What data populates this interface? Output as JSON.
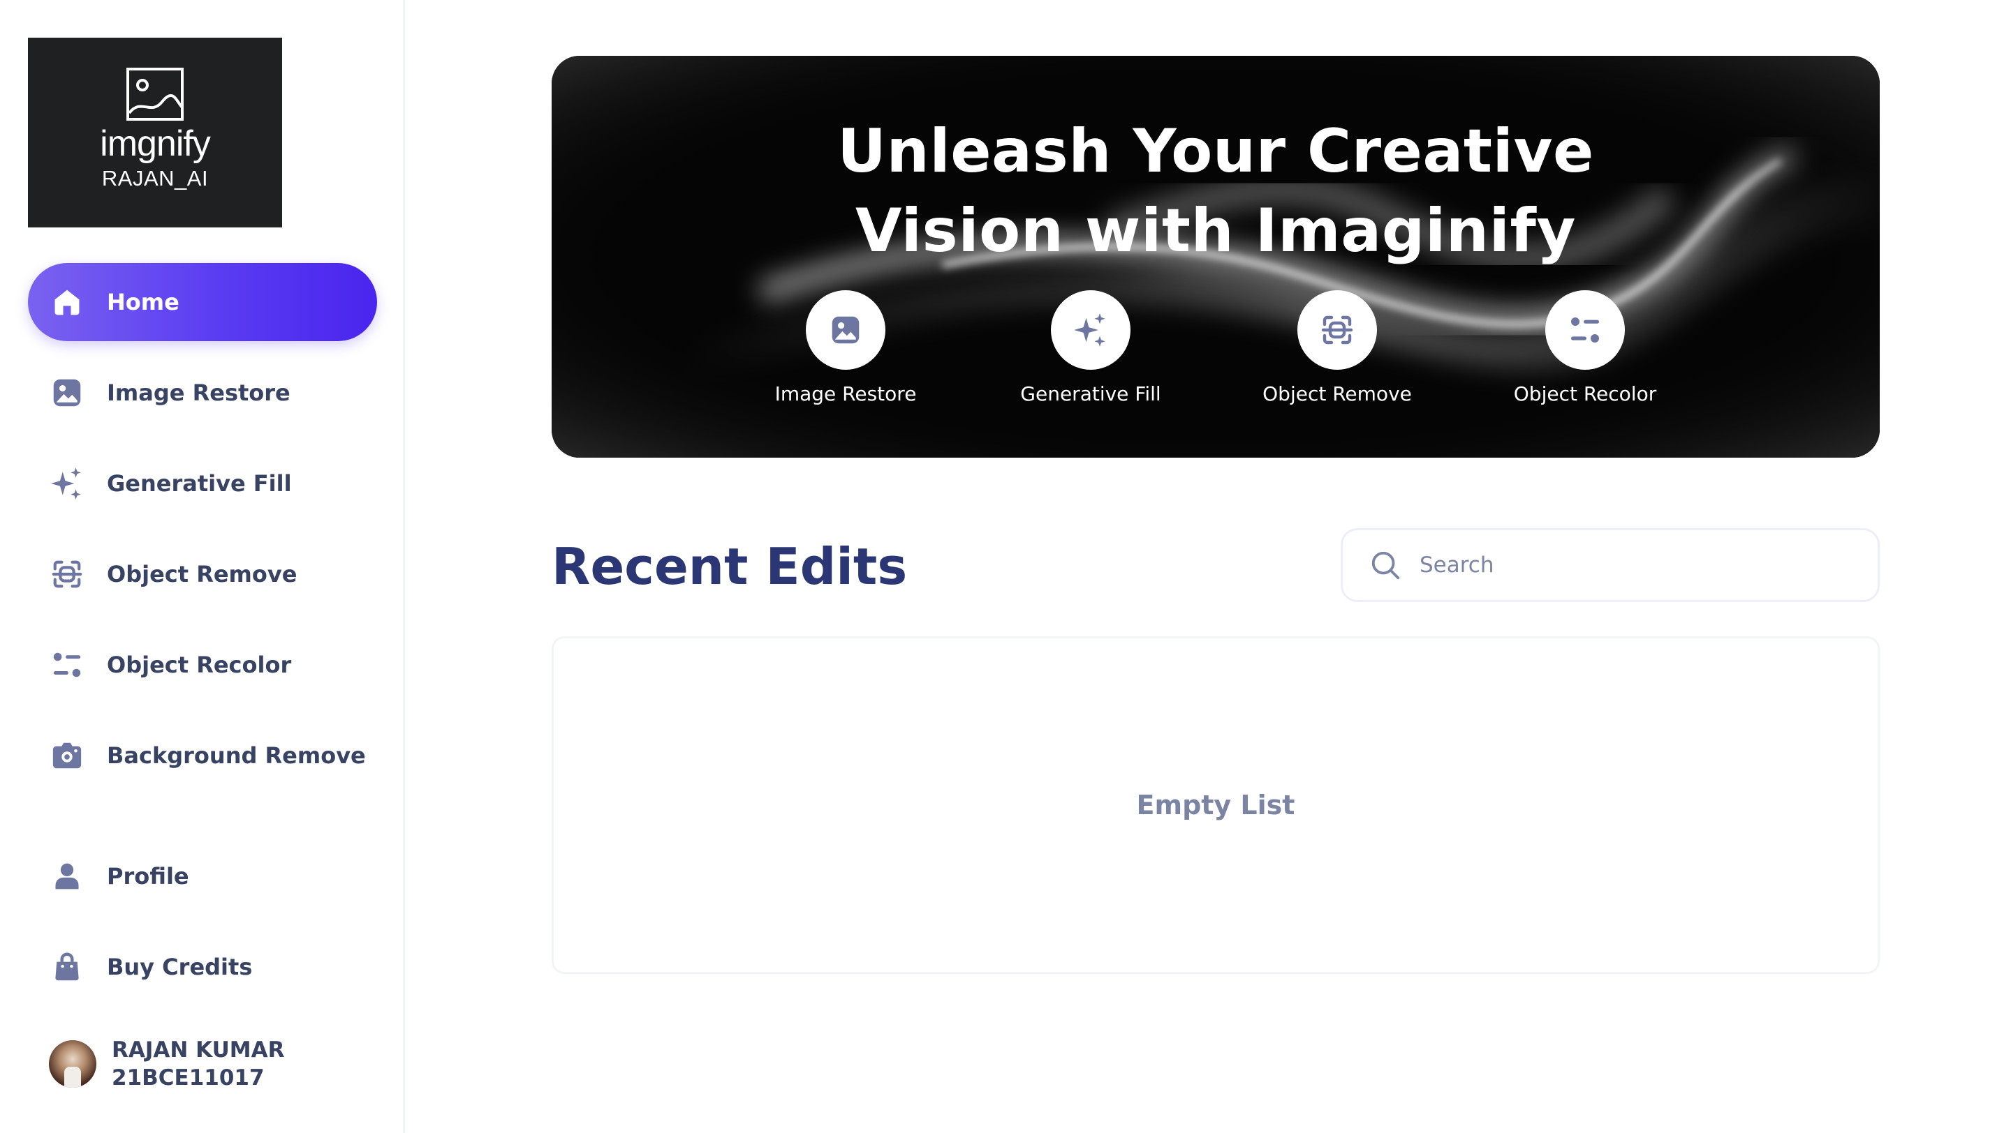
{
  "brand": {
    "name": "imgnify",
    "subtitle": "RAJAN_AI"
  },
  "sidebar": {
    "items": [
      {
        "label": "Home",
        "icon": "home-icon",
        "active": true
      },
      {
        "label": "Image Restore",
        "icon": "image-icon"
      },
      {
        "label": "Generative Fill",
        "icon": "sparkles-icon"
      },
      {
        "label": "Object Remove",
        "icon": "scan-icon"
      },
      {
        "label": "Object Recolor",
        "icon": "filter-icon"
      },
      {
        "label": "Background Remove",
        "icon": "camera-icon"
      },
      {
        "label": "Profile",
        "icon": "user-icon"
      },
      {
        "label": "Buy Credits",
        "icon": "bag-icon"
      }
    ],
    "user": {
      "name": "RAJAN KUMAR",
      "id": "21BCE11017"
    }
  },
  "banner": {
    "title_line1": "Unleash Your Creative",
    "title_line2": "Vision with Imaginify",
    "tools": [
      {
        "label": "Image Restore",
        "icon": "image-icon"
      },
      {
        "label": "Generative Fill",
        "icon": "sparkles-icon"
      },
      {
        "label": "Object Remove",
        "icon": "scan-icon"
      },
      {
        "label": "Object Recolor",
        "icon": "filter-icon"
      }
    ]
  },
  "recent": {
    "title": "Recent Edits",
    "search_placeholder": "Search",
    "search_value": "",
    "empty_text": "Empty List"
  },
  "colors": {
    "accent_start": "#7a62f0",
    "accent_end": "#4a25ee",
    "heading": "#2b3674",
    "text": "#384262",
    "muted": "#7b84a3",
    "icon": "#6c76a0"
  }
}
